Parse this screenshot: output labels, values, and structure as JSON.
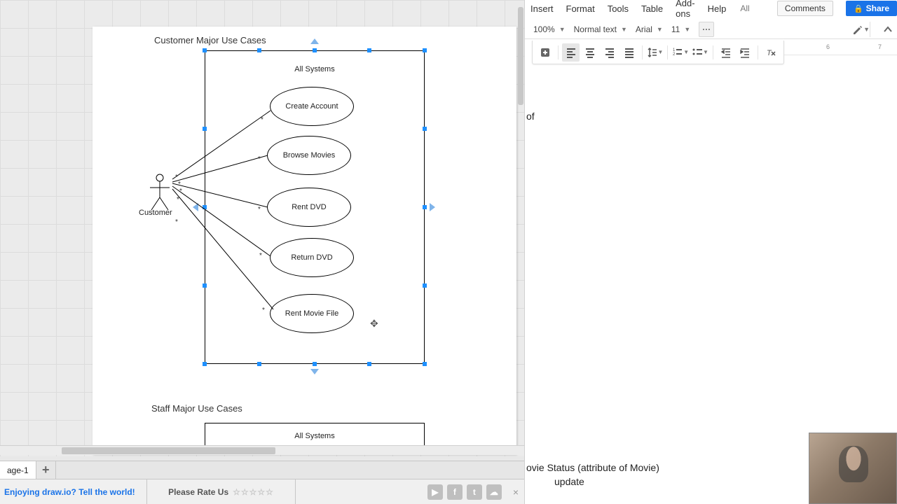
{
  "drawio": {
    "diagram1_title": "Customer Major Use Cases",
    "diagram2_title": "Staff Major Use Cases",
    "system_label": "All Systems",
    "system2_label": "All Systems",
    "actor_label": "Customer",
    "usecases": [
      "Create Account",
      "Browse Movies",
      "Rent DVD",
      "Return DVD",
      "Rent Movie File"
    ],
    "multiplicity": "*",
    "tabs": {
      "active": "age-1",
      "add": "+"
    },
    "promo_text": "Enjoying draw.io? Tell the world!",
    "rate_text": "Please Rate Us",
    "stars": "☆☆☆☆☆",
    "close": "×"
  },
  "docs": {
    "menu": {
      "insert": "Insert",
      "format": "Format",
      "tools": "Tools",
      "table": "Table",
      "addons": "Add-ons",
      "help": "Help",
      "status": "All change…",
      "comments": "Comments",
      "share": "Share"
    },
    "toolbar": {
      "zoom": "100%",
      "style": "Normal text",
      "font": "Arial",
      "size": "11",
      "more": "···"
    },
    "ruler": {
      "t6": "6",
      "t7": "7"
    },
    "body": {
      "frag_top": "of",
      "line2": "ovie Status (attribute of Movie)",
      "line3": "update"
    }
  }
}
